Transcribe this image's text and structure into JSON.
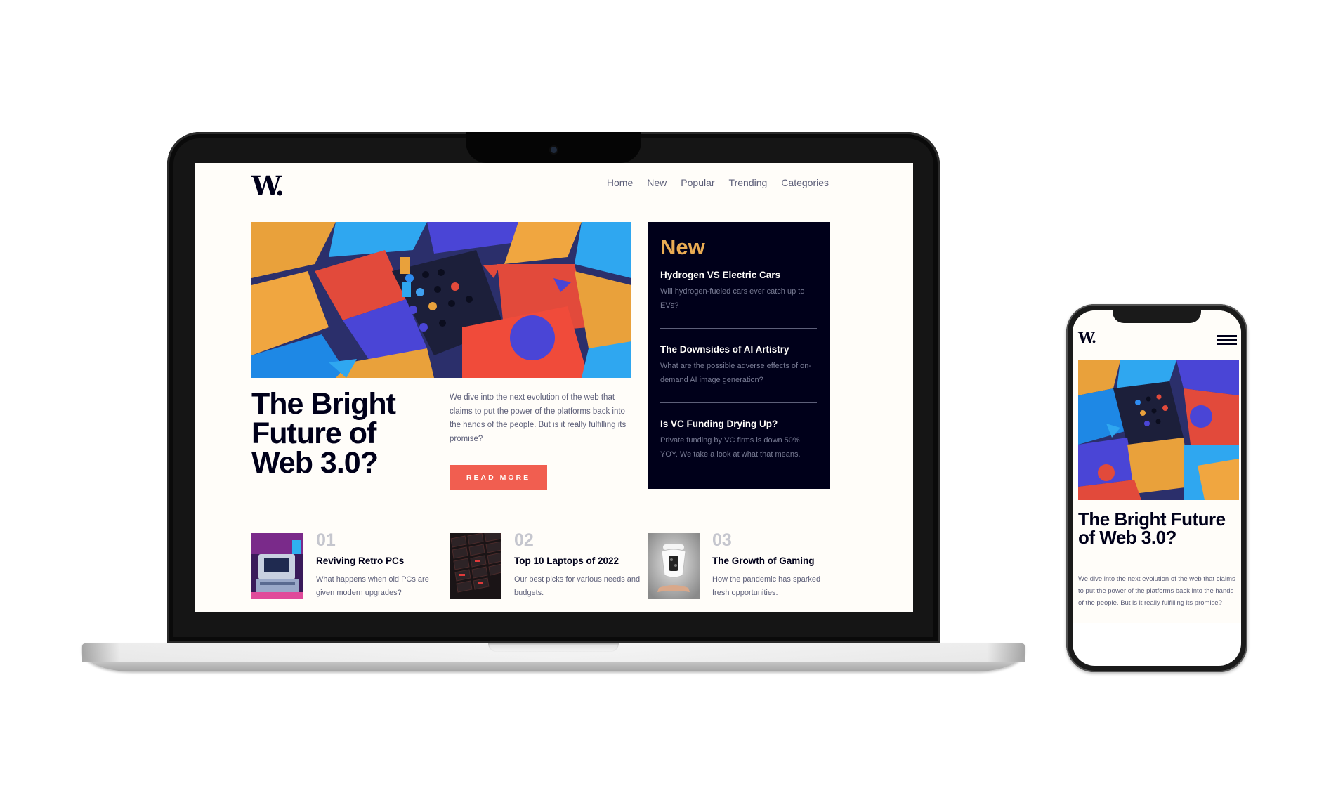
{
  "site": {
    "logo": "W.",
    "nav": [
      "Home",
      "New",
      "Popular",
      "Trending",
      "Categories"
    ]
  },
  "hero": {
    "title": "The Bright Future of Web 3.0?",
    "description": "We dive into the next evolution of the web that claims to put the power of the platforms back into the hands of the people. But is it really fulfilling its promise?",
    "button_label": "READ MORE",
    "mobile_title": "The Bright Future of Web 3.0?"
  },
  "new_panel": {
    "title": "New",
    "items": [
      {
        "title": "Hydrogen VS Electric Cars",
        "description": "Will hydrogen-fueled cars ever catch up to EVs?"
      },
      {
        "title": "The Downsides of AI Artistry",
        "description": "What are the possible adverse effects of on-demand AI image generation?"
      },
      {
        "title": "Is VC Funding Drying Up?",
        "description": "Private funding by VC firms is down 50% YOY. We take a look at what that means."
      }
    ]
  },
  "articles": [
    {
      "number": "01",
      "title": "Reviving Retro PCs",
      "description": "What happens when old PCs are given modern upgrades?"
    },
    {
      "number": "02",
      "title": "Top 10 Laptops of 2022",
      "description": "Our best picks for various needs and budgets."
    },
    {
      "number": "03",
      "title": "The Growth of Gaming",
      "description": "How the pandemic has sparked fresh opportunities."
    }
  ],
  "colors": {
    "dark_navy": "#00001a",
    "accent_red": "#f15e50",
    "accent_orange": "#e9ab53",
    "off_white": "#fffdf9",
    "grayish_blue": "#5d5f79"
  },
  "icons": {
    "mobile_menu": "hamburger-menu-icon"
  }
}
